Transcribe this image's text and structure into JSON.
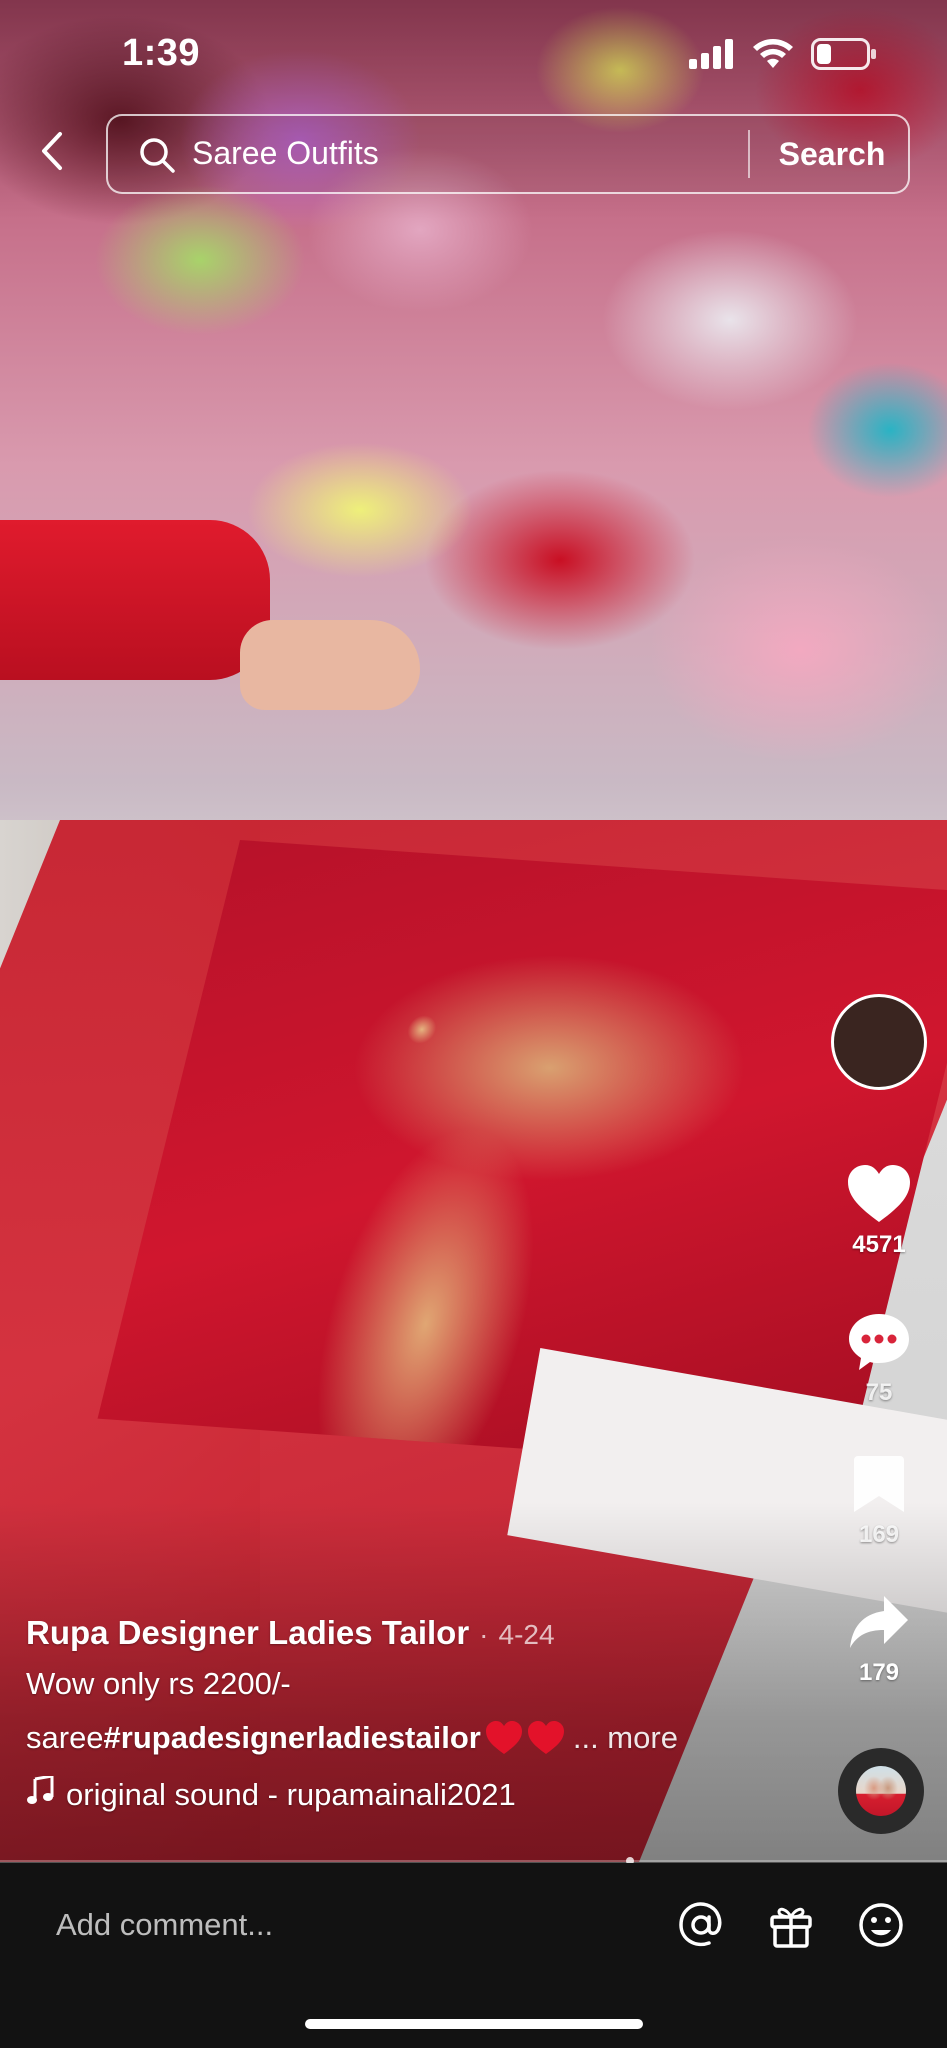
{
  "status_bar": {
    "time": "1:39",
    "icons": [
      "cellular-signal-icon",
      "wifi-icon",
      "battery-icon"
    ]
  },
  "search": {
    "query": "Saree Outfits",
    "button_label": "Search",
    "back_icon": "chevron-left-icon",
    "search_icon": "magnifier-icon"
  },
  "actions": {
    "likes": "4571",
    "comments": "75",
    "saves": "169",
    "shares": "179",
    "icons": [
      "heart-icon",
      "comment-bubble-icon",
      "bookmark-icon",
      "share-arrow-icon"
    ]
  },
  "post": {
    "author": "Rupa Designer Ladies Tailor",
    "date_separator": "·",
    "date": "4-24",
    "description_line1": "Wow only rs 2200/-",
    "description_prefix": "saree",
    "hashtag": "#rupadesignerladiestailor",
    "more_label": "... more",
    "sound": "original sound - rupamainali2021"
  },
  "comment_bar": {
    "placeholder": "Add comment...",
    "icons": [
      "mention-icon",
      "gift-icon",
      "emoji-icon"
    ]
  },
  "colors": {
    "heart_emoji": "#e3122a",
    "comment_bar_bg": "#121212"
  }
}
